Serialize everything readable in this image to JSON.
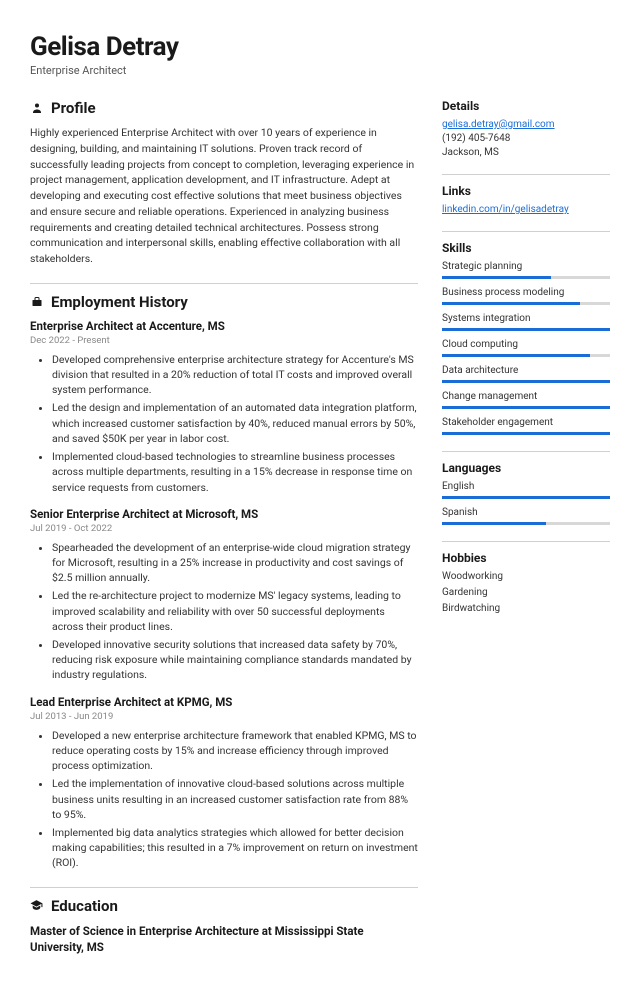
{
  "header": {
    "name": "Gelisa Detray",
    "title": "Enterprise Architect"
  },
  "profile": {
    "heading": "Profile",
    "text": "Highly experienced Enterprise Architect with over 10 years of experience in designing, building, and maintaining IT solutions. Proven track record of successfully leading projects from concept to completion, leveraging experience in project management, application development, and IT infrastructure. Adept at developing and executing cost effective solutions that meet business objectives and ensure secure and reliable operations. Experienced in analyzing business requirements and creating detailed technical architectures. Possess strong communication and interpersonal skills, enabling effective collaboration with all stakeholders."
  },
  "employment": {
    "heading": "Employment History",
    "jobs": [
      {
        "title": "Enterprise Architect at Accenture, MS",
        "dates": "Dec 2022 - Present",
        "bullets": [
          "Developed comprehensive enterprise architecture strategy for Accenture's MS division that resulted in a 20% reduction of total IT costs and improved overall system performance.",
          "Led the design and implementation of an automated data integration platform, which increased customer satisfaction by 40%, reduced manual errors by 50%, and saved $50K per year in labor cost.",
          "Implemented cloud-based technologies to streamline business processes across multiple departments, resulting in a 15% decrease in response time on service requests from customers."
        ]
      },
      {
        "title": "Senior Enterprise Architect at Microsoft, MS",
        "dates": "Jul 2019 - Oct 2022",
        "bullets": [
          "Spearheaded the development of an enterprise-wide cloud migration strategy for Microsoft, resulting in a 25% increase in productivity and cost savings of $2.5 million annually.",
          "Led the re-architecture project to modernize MS' legacy systems, leading to improved scalability and reliability with over 50 successful deployments across their product lines.",
          "Developed innovative security solutions that increased data safety by 70%, reducing risk exposure while maintaining compliance standards mandated by industry regulations."
        ]
      },
      {
        "title": "Lead Enterprise Architect at KPMG, MS",
        "dates": "Jul 2013 - Jun 2019",
        "bullets": [
          "Developed a new enterprise architecture framework that enabled KPMG, MS to reduce operating costs by 15% and increase efficiency through improved process optimization.",
          "Led the implementation of innovative cloud-based solutions across multiple business units resulting in an increased customer satisfaction rate from 88% to 95%.",
          "Implemented big data analytics strategies which allowed for better decision making capabilities; this resulted in a 7% improvement on return on investment (ROI)."
        ]
      }
    ]
  },
  "education": {
    "heading": "Education",
    "degree": "Master of Science in Enterprise Architecture at Mississippi State University, MS"
  },
  "details": {
    "heading": "Details",
    "email": "gelisa.detray@gmail.com",
    "phone": "(192) 405-7648",
    "location": "Jackson, MS"
  },
  "links": {
    "heading": "Links",
    "items": [
      {
        "text": "linkedin.com/in/gelisadetray"
      }
    ]
  },
  "skills": {
    "heading": "Skills",
    "items": [
      {
        "name": "Strategic planning",
        "level": 65
      },
      {
        "name": "Business process modeling",
        "level": 82
      },
      {
        "name": "Systems integration",
        "level": 100
      },
      {
        "name": "Cloud computing",
        "level": 88
      },
      {
        "name": "Data architecture",
        "level": 100
      },
      {
        "name": "Change management",
        "level": 100
      },
      {
        "name": "Stakeholder engagement",
        "level": 100
      }
    ]
  },
  "languages": {
    "heading": "Languages",
    "items": [
      {
        "name": "English",
        "level": 100
      },
      {
        "name": "Spanish",
        "level": 62
      }
    ]
  },
  "hobbies": {
    "heading": "Hobbies",
    "items": [
      "Woodworking",
      "Gardening",
      "Birdwatching"
    ]
  }
}
